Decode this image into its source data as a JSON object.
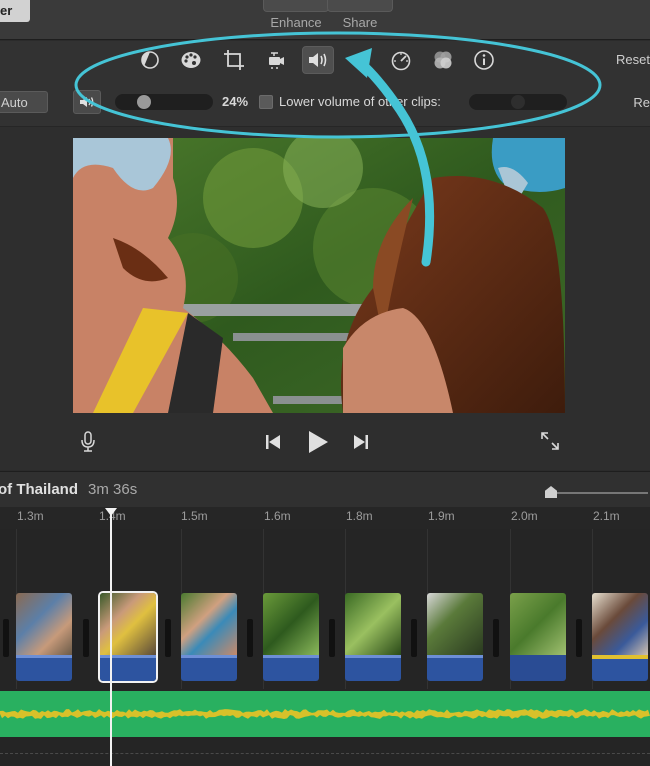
{
  "toolbar": {
    "left_button_label": "er",
    "enhance_label": "Enhance",
    "share_label": "Share"
  },
  "adjustments": {
    "icons": [
      "color-balance-icon",
      "color-correction-icon",
      "crop-icon",
      "stabilization-icon",
      "volume-icon",
      "noise-reduction-icon",
      "speed-icon",
      "clip-filter-icon",
      "info-icon"
    ],
    "selected": "volume-icon",
    "reset_label": "Reset"
  },
  "volume": {
    "auto_label": "Auto",
    "level_percent": "24%",
    "level_fraction": 0.24,
    "lower_label": "Lower volume of other clips:",
    "lower_checked": false,
    "reset_label": "Re"
  },
  "timeline": {
    "project_name": "of Thailand",
    "duration": "3m 36s",
    "ruler": [
      "1.3m",
      "1.4m",
      "1.5m",
      "1.6m",
      "1.8m",
      "1.9m",
      "2.0m",
      "2.1m"
    ]
  },
  "colors": {
    "annotation": "#45c4d6",
    "audio_clip": "#2d54a0",
    "music_track": "#29b060",
    "waveform": "#d8c12a"
  }
}
